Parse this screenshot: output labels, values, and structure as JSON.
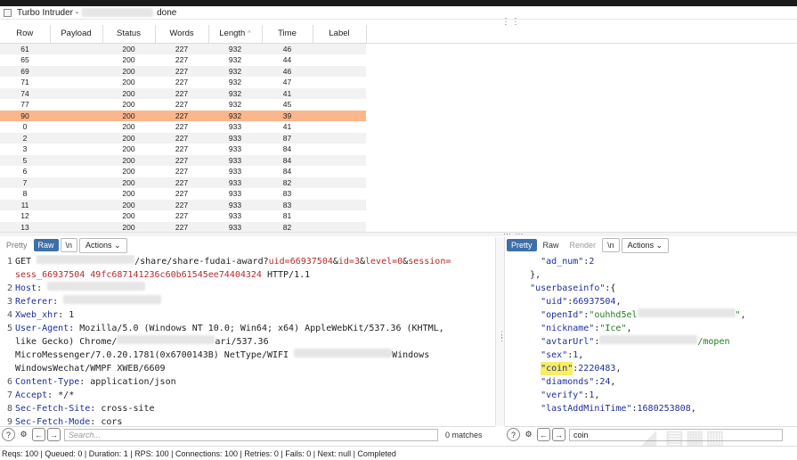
{
  "window": {
    "title_prefix": "Turbo Intruder -",
    "title_suffix": "done"
  },
  "table": {
    "columns": [
      "Row",
      "Payload",
      "Status",
      "Words",
      "Length",
      "Time",
      "Label"
    ],
    "sort_indicator": "^",
    "rows": [
      [
        "61",
        "",
        "200",
        "227",
        "932",
        "46",
        ""
      ],
      [
        "65",
        "",
        "200",
        "227",
        "932",
        "44",
        ""
      ],
      [
        "69",
        "",
        "200",
        "227",
        "932",
        "46",
        ""
      ],
      [
        "71",
        "",
        "200",
        "227",
        "932",
        "47",
        ""
      ],
      [
        "74",
        "",
        "200",
        "227",
        "932",
        "41",
        ""
      ],
      [
        "77",
        "",
        "200",
        "227",
        "932",
        "45",
        ""
      ],
      [
        "90",
        "",
        "200",
        "227",
        "932",
        "39",
        ""
      ],
      [
        "0",
        "",
        "200",
        "227",
        "933",
        "41",
        ""
      ],
      [
        "2",
        "",
        "200",
        "227",
        "933",
        "87",
        ""
      ],
      [
        "3",
        "",
        "200",
        "227",
        "933",
        "84",
        ""
      ],
      [
        "5",
        "",
        "200",
        "227",
        "933",
        "84",
        ""
      ],
      [
        "6",
        "",
        "200",
        "227",
        "933",
        "84",
        ""
      ],
      [
        "7",
        "",
        "200",
        "227",
        "933",
        "82",
        ""
      ],
      [
        "8",
        "",
        "200",
        "227",
        "933",
        "83",
        ""
      ],
      [
        "11",
        "",
        "200",
        "227",
        "933",
        "83",
        ""
      ],
      [
        "12",
        "",
        "200",
        "227",
        "933",
        "81",
        ""
      ],
      [
        "13",
        "",
        "200",
        "227",
        "933",
        "82",
        ""
      ]
    ],
    "selected_index": 6
  },
  "request_pane": {
    "tabs": {
      "pretty": "Pretty",
      "raw": "Raw",
      "newline": "\\n",
      "actions": "Actions"
    },
    "lines": [
      {
        "n": "1",
        "parts": [
          [
            "txt",
            "GET "
          ],
          [
            "blur",
            ""
          ],
          [
            "txt",
            "/share/share-fudai-award?"
          ],
          [
            "red",
            "uid=66937504"
          ],
          [
            "txt",
            "&"
          ],
          [
            "red",
            "id=3"
          ],
          [
            "txt",
            "&"
          ],
          [
            "red",
            "level=0"
          ],
          [
            "txt",
            "&"
          ],
          [
            "red",
            "session="
          ]
        ]
      },
      {
        "n": "",
        "parts": [
          [
            "red",
            "sess_66937504 49fc687141236c60b61545ee74404324"
          ],
          [
            "txt",
            " HTTP/1.1"
          ]
        ]
      },
      {
        "n": "2",
        "parts": [
          [
            "hdr",
            "Host"
          ],
          [
            "txt",
            ": "
          ],
          [
            "blur",
            ""
          ]
        ]
      },
      {
        "n": "3",
        "parts": [
          [
            "hdr",
            "Referer"
          ],
          [
            "txt",
            ": "
          ],
          [
            "blur",
            ""
          ]
        ]
      },
      {
        "n": "4",
        "parts": [
          [
            "hdr",
            "Xweb_xhr"
          ],
          [
            "txt",
            ": 1"
          ]
        ]
      },
      {
        "n": "5",
        "parts": [
          [
            "hdr",
            "User-Agent"
          ],
          [
            "txt",
            ": Mozilla/5.0 (Windows NT 10.0; Win64; x64) AppleWebKit/537.36 (KHTML,"
          ]
        ]
      },
      {
        "n": "",
        "parts": [
          [
            "txt",
            "like Gecko) Chrome/"
          ],
          [
            "blur",
            ""
          ],
          [
            "txt",
            "ari/537.36"
          ]
        ]
      },
      {
        "n": "",
        "parts": [
          [
            "txt",
            "MicroMessenger/7.0.20.1781(0x6700143B) NetType/WIFI "
          ],
          [
            "blur",
            ""
          ],
          [
            "txt",
            "Windows"
          ]
        ]
      },
      {
        "n": "",
        "parts": [
          [
            "txt",
            "WindowsWechat/WMPF XWEB/6609"
          ]
        ]
      },
      {
        "n": "6",
        "parts": [
          [
            "hdr",
            "Content-Type"
          ],
          [
            "txt",
            ": application/json"
          ]
        ]
      },
      {
        "n": "7",
        "parts": [
          [
            "hdr",
            "Accept"
          ],
          [
            "txt",
            ": */*"
          ]
        ]
      },
      {
        "n": "8",
        "parts": [
          [
            "hdr",
            "Sec-Fetch-Site"
          ],
          [
            "txt",
            ": cross-site"
          ]
        ]
      },
      {
        "n": "9",
        "parts": [
          [
            "hdr",
            "Sec-Fetch-Mode"
          ],
          [
            "txt",
            ": cors"
          ]
        ]
      }
    ],
    "search_placeholder": "Search...",
    "matches": "0 matches"
  },
  "response_pane": {
    "tabs": {
      "pretty": "Pretty",
      "raw": "Raw",
      "render": "Render",
      "newline": "\\n",
      "actions": "Actions"
    },
    "lines": [
      {
        "parts": [
          [
            "txt",
            "      "
          ],
          [
            "key",
            "\"ad_num\""
          ],
          [
            "txt",
            ":"
          ],
          [
            "num",
            "2"
          ]
        ]
      },
      {
        "parts": [
          [
            "txt",
            "    },"
          ]
        ]
      },
      {
        "parts": [
          [
            "txt",
            "    "
          ],
          [
            "key",
            "\"userbaseinfo\""
          ],
          [
            "txt",
            ":{"
          ]
        ]
      },
      {
        "parts": [
          [
            "txt",
            "      "
          ],
          [
            "key",
            "\"uid\""
          ],
          [
            "txt",
            ":"
          ],
          [
            "num",
            "66937504"
          ],
          [
            "txt",
            ","
          ]
        ]
      },
      {
        "parts": [
          [
            "txt",
            "      "
          ],
          [
            "key",
            "\"openId\""
          ],
          [
            "txt",
            ":"
          ],
          [
            "str",
            "\"ouhhd5el"
          ],
          [
            "blur",
            ""
          ],
          [
            "str",
            "\""
          ],
          [
            "txt",
            ","
          ]
        ]
      },
      {
        "parts": [
          [
            "txt",
            "      "
          ],
          [
            "key",
            "\"nickname\""
          ],
          [
            "txt",
            ":"
          ],
          [
            "str",
            "\"Ice\""
          ],
          [
            "txt",
            ","
          ]
        ]
      },
      {
        "parts": [
          [
            "txt",
            "      "
          ],
          [
            "key",
            "\"avtarUrl\""
          ],
          [
            "txt",
            ":"
          ],
          [
            "blur",
            ""
          ],
          [
            "str",
            "/mopen"
          ]
        ]
      },
      {
        "parts": [
          [
            "txt",
            "      "
          ],
          [
            "key",
            "\"sex\""
          ],
          [
            "txt",
            ":"
          ],
          [
            "num",
            "1"
          ],
          [
            "txt",
            ","
          ]
        ]
      },
      {
        "parts": [
          [
            "txt",
            "      "
          ],
          [
            "hl",
            "\"coin\""
          ],
          [
            "txt",
            ":"
          ],
          [
            "num",
            "2220483"
          ],
          [
            "txt",
            ","
          ]
        ]
      },
      {
        "parts": [
          [
            "txt",
            "      "
          ],
          [
            "key",
            "\"diamonds\""
          ],
          [
            "txt",
            ":"
          ],
          [
            "num",
            "24"
          ],
          [
            "txt",
            ","
          ]
        ]
      },
      {
        "parts": [
          [
            "txt",
            "      "
          ],
          [
            "key",
            "\"verify\""
          ],
          [
            "txt",
            ":"
          ],
          [
            "num",
            "1"
          ],
          [
            "txt",
            ","
          ]
        ]
      },
      {
        "parts": [
          [
            "txt",
            "      "
          ],
          [
            "key",
            "\"lastAddMiniTime\""
          ],
          [
            "txt",
            ":"
          ],
          [
            "num",
            "1680253808"
          ],
          [
            "txt",
            ","
          ]
        ]
      }
    ],
    "search_value": "coin"
  },
  "status_bar": "Reqs: 100 | Queued: 0 | Duration: 1 | RPS: 100 | Connections: 100 | Retries: 0 | Fails: 0 | Next: null | Completed",
  "icons": {
    "help": "?",
    "settings": "⚙",
    "back": "←",
    "forward": "→"
  }
}
